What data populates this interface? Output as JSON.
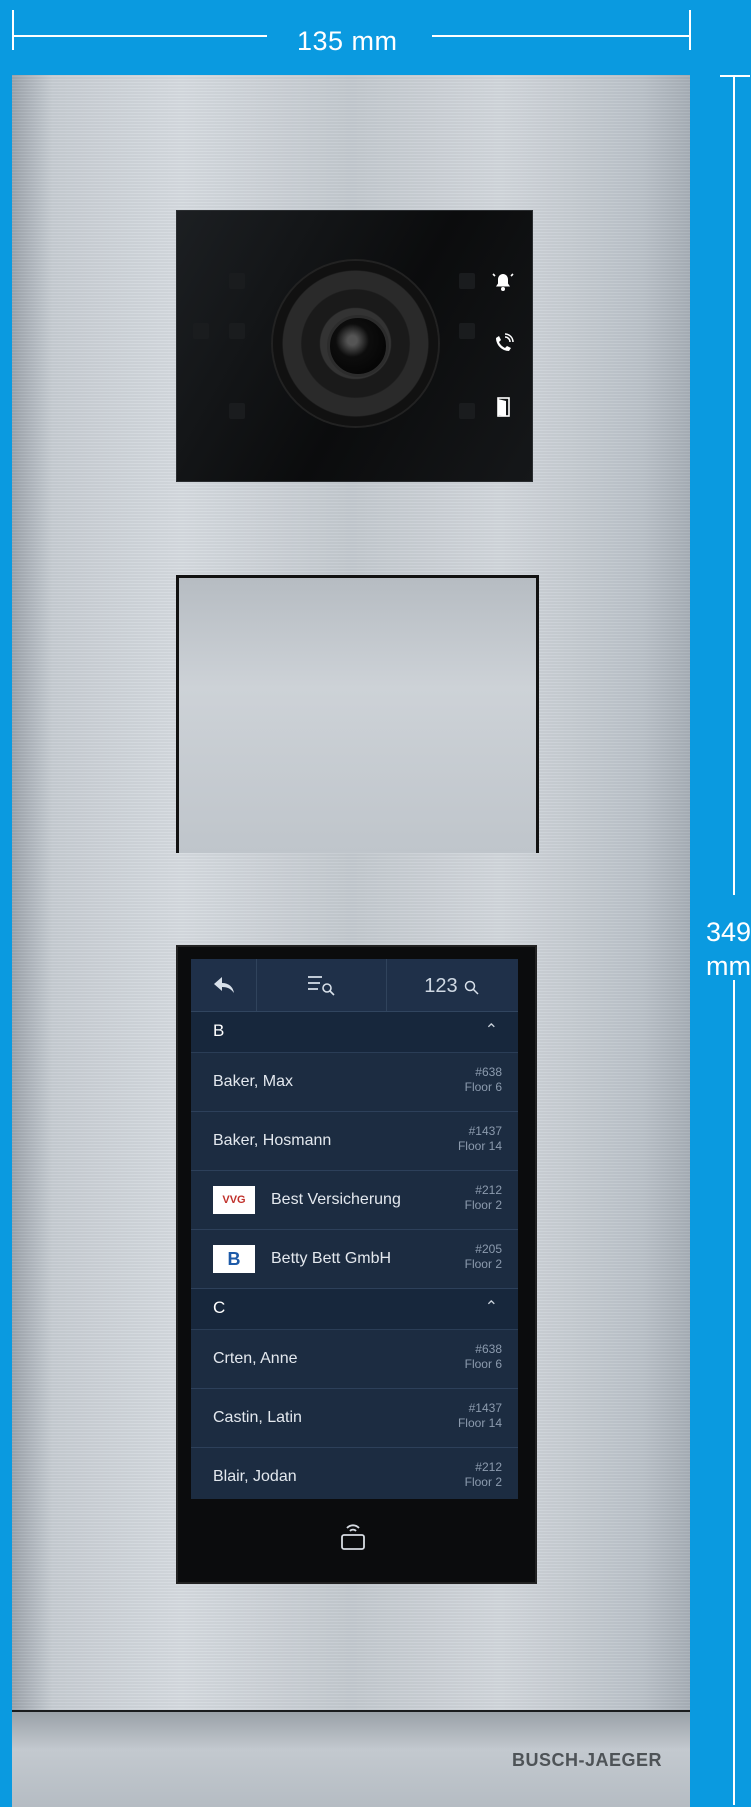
{
  "dimensions": {
    "width_label": "135 mm",
    "height_label_1": "349",
    "height_label_2": "mm"
  },
  "camera": {
    "icons": [
      "bell-icon",
      "phone-icon",
      "door-icon"
    ]
  },
  "display": {
    "toolbar": {
      "back": "↩",
      "list_search": "☰",
      "number_search": "123"
    },
    "sections": [
      {
        "letter": "B",
        "entries": [
          {
            "name": "Baker, Max",
            "apt": "#638",
            "floor": "Floor 6"
          },
          {
            "name": "Baker, Hosmann",
            "apt": "#1437",
            "floor": "Floor 14"
          },
          {
            "name": "Best Versicherung",
            "apt": "#212",
            "floor": "Floor 2",
            "logo": "VVG"
          },
          {
            "name": "Betty Bett GmbH",
            "apt": "#205",
            "floor": "Floor 2",
            "logo": "B"
          }
        ]
      },
      {
        "letter": "C",
        "entries": [
          {
            "name": "Crten, Anne",
            "apt": "#638",
            "floor": "Floor 6"
          },
          {
            "name": "Castin, Latin",
            "apt": "#1437",
            "floor": "Floor 14"
          },
          {
            "name": "Blair, Jodan",
            "apt": "#212",
            "floor": "Floor 2"
          }
        ]
      }
    ]
  },
  "brand": "BUSCH-JAEGER"
}
